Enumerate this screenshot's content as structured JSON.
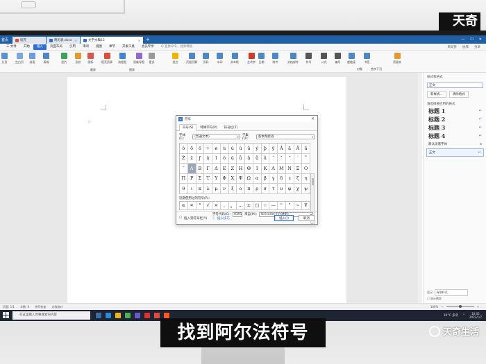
{
  "watermark": {
    "top": "天奇",
    "bottom": "天奇生活"
  },
  "caption": "找到阿尔法符号",
  "titlebar": {
    "home": "首页",
    "tabs": [
      {
        "label": "稻壳",
        "color": "#e04b3a"
      },
      {
        "label": "简历表.docx",
        "color": "#2e6fd1"
      },
      {
        "label": "文字文稿15",
        "color": "#2e6fd1"
      }
    ],
    "plus": "+"
  },
  "menu": {
    "items": [
      "三 文件",
      "开始",
      "插入",
      "页面布局",
      "引用",
      "审阅",
      "视图",
      "章节",
      "开发工具",
      "会员专享"
    ],
    "active_index": 2,
    "search": "Q 查找命令、搜索模板",
    "right": [
      "未同步",
      "协作",
      "分享"
    ]
  },
  "ribbon": {
    "left_buttons": [
      "分页",
      "空白页",
      "封面",
      "表格",
      "图片",
      "形状",
      "图标",
      "稻壳资源",
      "流程图",
      "思维导图",
      "更多",
      "批注",
      "页眉页脚",
      "页码",
      "水印",
      "文本框",
      "艺术字",
      "日期",
      "附件",
      "文档部件",
      "符号",
      "公式",
      "编号",
      "超链接",
      "书签",
      "资源夹"
    ],
    "row_items": [
      "截屏",
      "智能图形",
      "图表",
      "对象",
      "首字下沉"
    ]
  },
  "statusbar": {
    "left": [
      "页面: 1/1",
      "字数: 0",
      "拼写检查",
      "文档校对"
    ],
    "zoom": "100%"
  },
  "right_panel": {
    "title": "样式和格式",
    "current": "正文",
    "buttons": [
      "新样式...",
      "清除格式"
    ],
    "section": "请选择要应用的格式",
    "styles": [
      {
        "name": "标题 1",
        "big": true
      },
      {
        "name": "标题 2",
        "big": true
      },
      {
        "name": "标题 3",
        "big": true
      },
      {
        "name": "标题 4",
        "big": true
      },
      {
        "name": "默认段落字体",
        "big": false
      },
      {
        "name": "正文",
        "big": false
      }
    ],
    "show_label": "显示:",
    "show_value": "有效样式",
    "preview": "显示预览"
  },
  "dialog": {
    "title": "符号",
    "tabs": [
      "符号(S)",
      "特殊字符(P)",
      "符号栏(T)"
    ],
    "font_label": "字体(F):",
    "font_value": "(普通文本)",
    "subset_label": "子集(U):",
    "subset_value": "基本希腊语",
    "grid": [
      [
        "ô",
        "õ",
        "ö",
        "÷",
        "ø",
        "ù",
        "ú",
        "û",
        "ü",
        "ý",
        "þ",
        "ÿ",
        "Ā",
        "ā",
        "Ă",
        "ă"
      ],
      [
        "Ž",
        "ž",
        "ƒ",
        "ǎ",
        "ǐ",
        "ǒ",
        "ǔ",
        "ǖ",
        "ǘ",
        "ǚ",
        "ǜ",
        "ˆ",
        "ˇ",
        "˘",
        "˙",
        "˚"
      ],
      [
        "˝",
        "Α",
        "Β",
        "Γ",
        "Δ",
        "Ε",
        "Ζ",
        "Η",
        "Θ",
        "Ι",
        "Κ",
        "Λ",
        "Μ",
        "Ν",
        "Ξ",
        "Ο"
      ],
      [
        "Π",
        "Ρ",
        "Σ",
        "Τ",
        "Υ",
        "Φ",
        "Χ",
        "Ψ",
        "Ω",
        "α",
        "β",
        "γ",
        "δ",
        "ε",
        "ζ",
        "η"
      ],
      [
        "θ",
        "ι",
        "κ",
        "λ",
        "μ",
        "ν",
        "ξ",
        "ο",
        "π",
        "ρ",
        "σ",
        "τ",
        "υ",
        "φ",
        "χ",
        "ψ"
      ]
    ],
    "selected": [
      2,
      1
    ],
    "recent_label": "近期使用过的符号(R):",
    "recent": [
      "α",
      "¤",
      "°",
      "√",
      "×",
      ",",
      "。",
      "…",
      "±",
      "□",
      "☆",
      "—",
      "\"",
      "\"",
      "~",
      "¥"
    ],
    "code_label": "字符代码(C):",
    "code_value": "0391",
    "from_label": "来自(M):",
    "from_value": "Unicode(十六进制)",
    "checkbox": "插入到符号栏(Y)",
    "tip": "插入技巧",
    "insert_btn": "插入(I)",
    "cancel_btn": "取消"
  },
  "taskbar": {
    "search": "在这里输入你要搜索的内容",
    "weather": "10°C 多云",
    "time": "18:02",
    "date": "2022/1/7"
  }
}
